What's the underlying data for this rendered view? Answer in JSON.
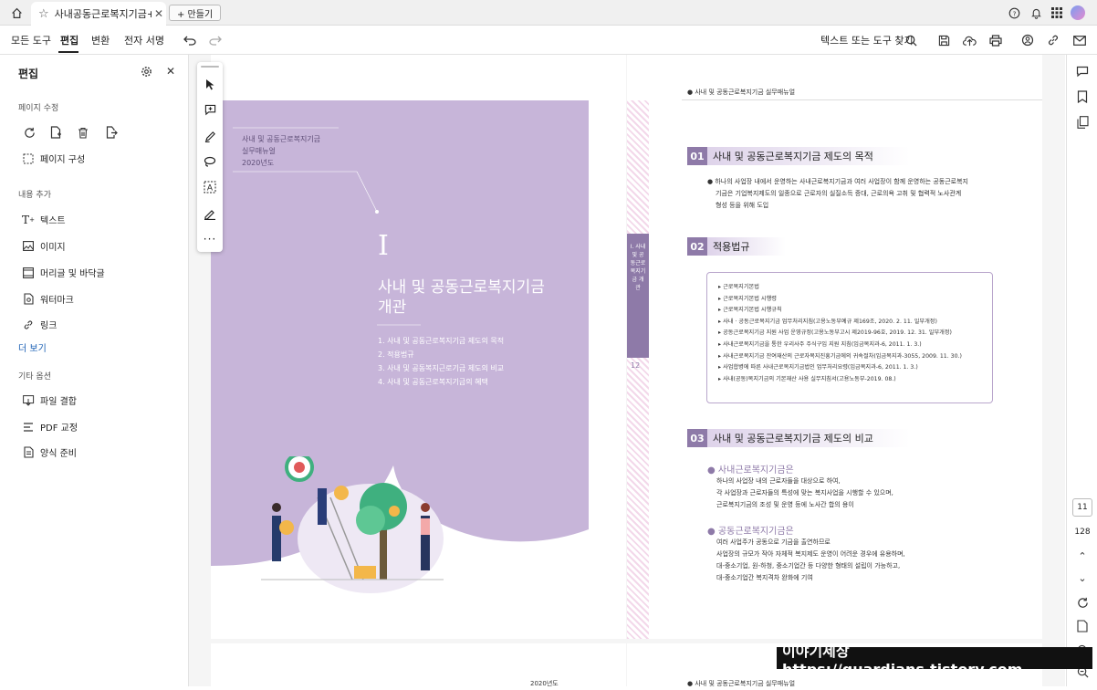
{
  "tabs": {
    "active_title": "사내공동근로복지기금+...",
    "new_tab": "+ 만들기"
  },
  "menu": {
    "all_tools": "모든 도구",
    "edit": "편집",
    "convert": "변환",
    "esign": "전자 서명",
    "search_label": "텍스트 또는 도구 찾기"
  },
  "panel": {
    "title": "편집",
    "sec_page": "페이지 수정",
    "page_org": "페이지 구성",
    "sec_add": "내용 추가",
    "text": "텍스트",
    "image": "이미지",
    "header_footer": "머리글 및 바닥글",
    "watermark": "워터마크",
    "link": "링크",
    "more": "더 보기",
    "sec_other": "기타 옵션",
    "combine": "파일 결합",
    "pdf_proof": "PDF 교정",
    "form": "양식 준비"
  },
  "left_page": {
    "sub1": "사내 및 공동근로복지기금",
    "sub2": "실무매뉴얼",
    "sub3": "2020년도",
    "roman": "I",
    "title1": "사내 및 공동근로복지기금",
    "title2": "개관",
    "toc": [
      "1. 사내 및 공동근로복지기금 제도의 목적",
      "2. 적용법규",
      "3. 사내 및 공동복지근로기금 제도의 비교",
      "4. 사내 및 공동근로복지기금의 혜택"
    ]
  },
  "right_page": {
    "header": "사내 및 공동근로복지기금 실무매뉴얼",
    "side_tab": "I. 사내 및 공동근로복지기금 개관",
    "page_num": "12",
    "s1_num": "01",
    "s1_title": "사내 및 공동근로복지기금 제도의 목적",
    "s1_body": [
      "하나의 사업장 내에서 운영하는 사내근로복지기금과 여러 사업장이 함께 운영하는 공동근로복지",
      "기금은 기업복지제도의 일종으로 근로자의 실질소득 증대, 근로의욕 고취 및 협력적 노사관계",
      "형성 등을 위해 도입"
    ],
    "s2_num": "02",
    "s2_title": "적용법규",
    "laws": [
      "근로복지기본법",
      "근로복지기본법 시행령",
      "근로복지기본법 시행규칙",
      "사내 · 공동근로복지기금 업무처리지침(고용노동부예규 제169조, 2020. 2. 11. 일부개정)",
      "공동근로복지기금 지원 사업 운영규정(고용노동부고시 제2019-96호, 2019. 12. 31. 일부개정)",
      "사내근로복지기금을 통한 우리사주 주식구입 지원 지침(임금복지과-6, 2011. 1. 3.)",
      "사내근로복지기금 잔여재산의 근로자복지진흥기금에의 귀속절차(임금복지과-3055, 2009. 11. 30.)",
      "사업합병에 따른 사내근로복지기금법인 업무처리요령(임금복지과-6, 2011. 1. 3.)",
      "사내(공동)복지기금의 기본재산 사용 실무지침서(고용노동부-2019. 08.)"
    ],
    "s3_num": "03",
    "s3_title": "사내 및 공동근로복지기금 제도의 비교",
    "b1_title": "사내근로복지기금은",
    "b1_body": [
      "하나의 사업장 내의 근로자들을 대상으로 하여,",
      "각 사업장과 근로자들의 특성에 맞는 복지사업을 시행할 수 있으며,",
      "근로복지기금의 조성 및 운영 등에 노사간 합의 용이"
    ],
    "b2_title": "공동근로복지기금은",
    "b2_body": [
      "여러 사업주가 공동으로 기금을 출연하므로",
      "사업장의 규모가 작아 자체적 복지제도 운영이 어려운 경우에 유용하며,",
      "대-중소기업, 원-하청, 중소기업간 등 다양한 형태의 설립이 가능하고,",
      "대-중소기업간 복지격차 완화에 기여"
    ],
    "next_header": "사내 및 공동근로복지기금 실무매뉴얼"
  },
  "next_left": "2020년도",
  "rail": {
    "page": "11",
    "total": "128"
  },
  "watermark": "이야기세상 https://guardians.tistory.com",
  "colors": {
    "purple": "#c7b5d9",
    "accent": "#8e7aa8",
    "link": "#1a5fb4"
  }
}
